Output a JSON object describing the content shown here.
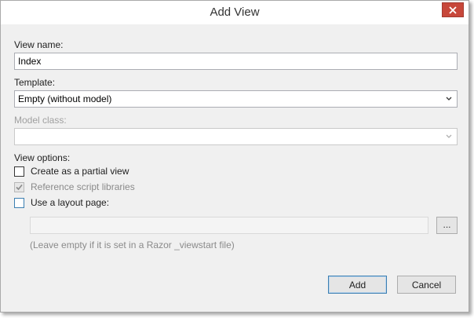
{
  "window": {
    "title": "Add View"
  },
  "fields": {
    "view_name_label": "View name:",
    "view_name_value": "Index",
    "template_label": "Template:",
    "template_value": "Empty (without model)",
    "model_class_label": "Model class:",
    "model_class_value": ""
  },
  "view_options": {
    "label": "View options:",
    "partial": {
      "label": "Create as a partial view",
      "checked": false,
      "enabled": true
    },
    "scripts": {
      "label": "Reference script libraries",
      "checked": true,
      "enabled": false
    },
    "layout": {
      "label": "Use a layout page:",
      "checked": false,
      "enabled": true
    },
    "layout_path_value": "",
    "browse_label": "...",
    "hint": "(Leave empty if it is set in a Razor _viewstart file)"
  },
  "buttons": {
    "add": "Add",
    "cancel": "Cancel"
  },
  "colors": {
    "close_red": "#c7473a",
    "focus_blue": "#3c7fb1"
  }
}
